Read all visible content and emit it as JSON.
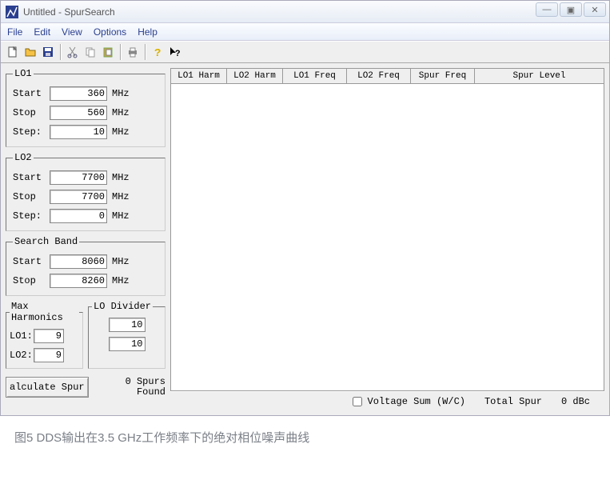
{
  "window": {
    "title": "Untitled - SpurSearch",
    "controls": {
      "min": "—",
      "max": "▣",
      "close": "✕"
    }
  },
  "menu": {
    "file": "File",
    "edit": "Edit",
    "view": "View",
    "options": "Options",
    "help": "Help"
  },
  "lo1": {
    "legend": "LO1",
    "start_lbl": "Start",
    "start_val": "360",
    "start_unit": "MHz",
    "stop_lbl": "Stop",
    "stop_val": "560",
    "stop_unit": "MHz",
    "step_lbl": "Step:",
    "step_val": "10",
    "step_unit": "MHz"
  },
  "lo2": {
    "legend": "LO2",
    "start_lbl": "Start",
    "start_val": "7700",
    "start_unit": "MHz",
    "stop_lbl": "Stop",
    "stop_val": "7700",
    "stop_unit": "MHz",
    "step_lbl": "Step:",
    "step_val": "0",
    "step_unit": "MHz"
  },
  "search_band": {
    "legend": "Search Band",
    "start_lbl": "Start",
    "start_val": "8060",
    "start_unit": "MHz",
    "stop_lbl": "Stop",
    "stop_val": "8260",
    "stop_unit": "MHz"
  },
  "max_harmonics": {
    "legend": "Max Harmonics",
    "lo1_lbl": "LO1:",
    "lo1_val": "9",
    "lo2_lbl": "LO2:",
    "lo2_val": "9"
  },
  "lo_divider": {
    "legend": "LO Divider",
    "row1_val": "10",
    "row2_val": "10"
  },
  "calc_btn": "alculate Spur",
  "spurs_found_count": "0 Spurs",
  "spurs_found_label": "Found",
  "grid": {
    "cols": [
      "LO1 Harm",
      "LO2 Harm",
      "LO1 Freq",
      "LO2 Freq",
      "Spur Freq",
      "Spur Level"
    ]
  },
  "status": {
    "voltage_sum": "Voltage Sum (W/C)",
    "total_spur_lbl": "Total Spur",
    "total_spur_val": "0",
    "total_spur_unit": "dBc"
  },
  "caption": "图5 DDS输出在3.5 GHz工作频率下的绝对相位噪声曲线"
}
